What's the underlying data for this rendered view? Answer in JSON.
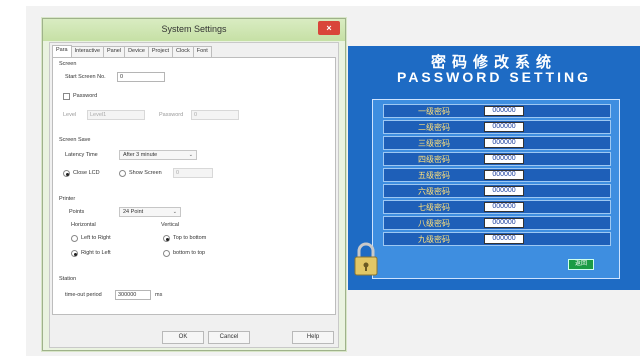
{
  "dialog": {
    "title": "System Settings",
    "close_label": "×",
    "tabs": [
      {
        "label": "Para",
        "active": true
      },
      {
        "label": "Interactive",
        "active": false
      },
      {
        "label": "Panel",
        "active": false
      },
      {
        "label": "Device",
        "active": false
      },
      {
        "label": "Project",
        "active": false
      },
      {
        "label": "Clock",
        "active": false
      },
      {
        "label": "Font",
        "active": false
      }
    ],
    "screen": {
      "section_label": "Screen",
      "start_screen_label": "Start Screen No.",
      "start_screen_value": "0",
      "password_check_label": "Password",
      "password_checked": false,
      "level_label": "Level",
      "level_value": "Level1",
      "password_label": "Password",
      "password_value": "0"
    },
    "screen_save": {
      "section_label": "Screen Save",
      "latency_label": "Latency Time",
      "latency_value": "After 3 minute",
      "close_lcd_label": "Close LCD",
      "close_lcd_selected": true,
      "show_screen_label": "Show Screen",
      "show_screen_value": "0"
    },
    "printer": {
      "section_label": "Printer",
      "points_label": "Points",
      "points_value": "24 Point",
      "horizontal_label": "Horizontal",
      "left_to_right_label": "Left to Right",
      "right_to_left_label": "Right to Left",
      "horizontal_selected": "Right to Left",
      "vertical_label": "Vertical",
      "top_to_bottom_label": "Top to bottom",
      "bottom_to_top_label": "bottom to top",
      "vertical_selected": "Top to bottom"
    },
    "station": {
      "section_label": "Station",
      "timeout_label": "time-out period",
      "timeout_value": "300000",
      "timeout_unit": "ms"
    },
    "buttons": {
      "ok": "OK",
      "cancel": "Cancel",
      "help": "Help"
    },
    "colors": {
      "titlebar": "#d2e8b6",
      "close": "#d9463a"
    }
  },
  "password_screen": {
    "title_cn": "密码修改系统",
    "title_en": "PASSWORD SETTING",
    "rows": [
      {
        "label": "一级密码",
        "value": "000000"
      },
      {
        "label": "二级密码",
        "value": "000000"
      },
      {
        "label": "三级密码",
        "value": "000000"
      },
      {
        "label": "四级密码",
        "value": "000000"
      },
      {
        "label": "五级密码",
        "value": "000000"
      },
      {
        "label": "六级密码",
        "value": "000000"
      },
      {
        "label": "七级密码",
        "value": "000000"
      },
      {
        "label": "八级密码",
        "value": "000000"
      },
      {
        "label": "九级密码",
        "value": "000000"
      }
    ],
    "back_label": "返回",
    "lock_icon": "padlock-icon",
    "colors": {
      "background": "#1e6bc4",
      "label_text": "#ffe07a",
      "back_button": "#1a9b45"
    }
  }
}
